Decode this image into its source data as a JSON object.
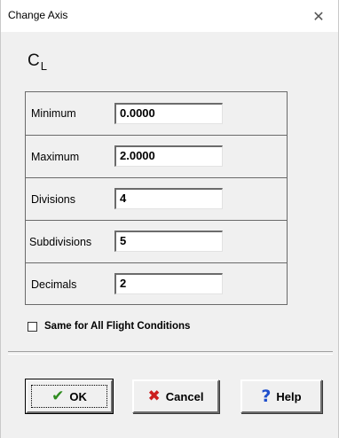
{
  "window": {
    "title": "Change Axis",
    "close_glyph": "✕"
  },
  "axis": {
    "symbol": "C",
    "subscript": "L"
  },
  "fields": [
    {
      "label": "Minimum",
      "value": "0.0000"
    },
    {
      "label": "Maximum",
      "value": "2.0000"
    },
    {
      "label": "Divisions",
      "value": "4"
    },
    {
      "label": "Subdivisions",
      "value": "5"
    },
    {
      "label": "Decimals",
      "value": "2"
    }
  ],
  "options": {
    "same_for_all_label": "Same for All Flight Conditions",
    "same_for_all_checked": false
  },
  "buttons": {
    "ok_label": "OK",
    "cancel_label": "Cancel",
    "help_label": "Help"
  },
  "icons": {
    "ok": "check-icon",
    "cancel": "x-icon",
    "help": "question-mark-icon"
  },
  "colors": {
    "ok_check": "#2e8b1f",
    "cancel_x": "#cc1f1f",
    "help_question": "#1f4fcc"
  }
}
